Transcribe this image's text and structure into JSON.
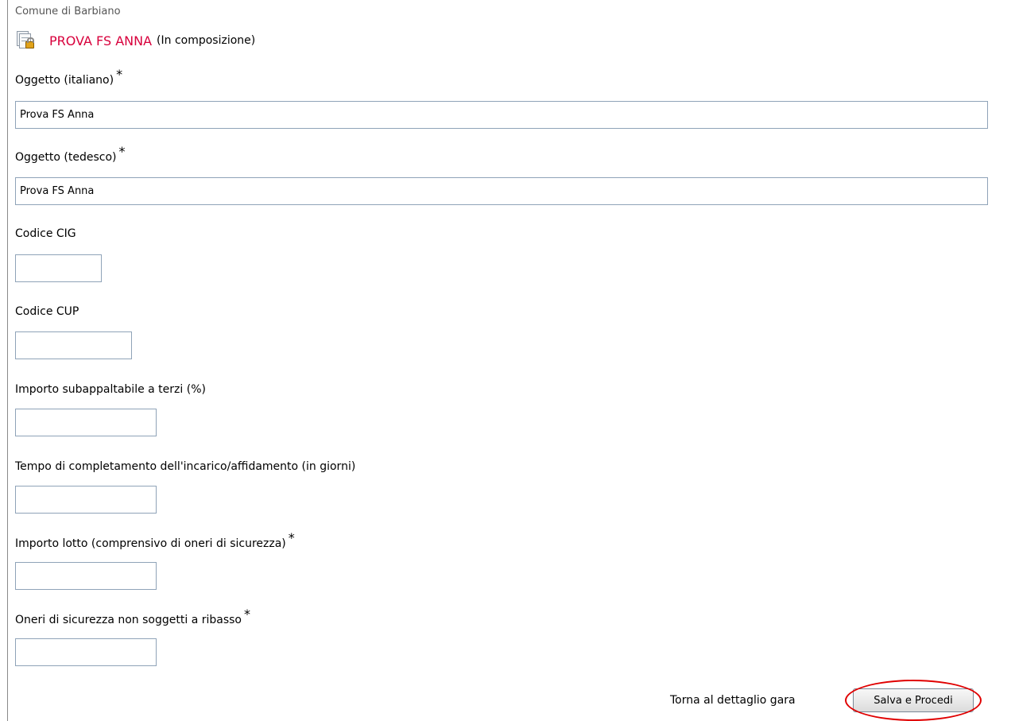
{
  "header": {
    "organization": "Comune di Barbiano",
    "title": "PROVA FS ANNA",
    "status": "(In composizione)",
    "icon": "locked-document-icon"
  },
  "form": {
    "required_marker": "*",
    "oggetto_it": {
      "label": "Oggetto (italiano)",
      "value": "Prova FS Anna"
    },
    "oggetto_de": {
      "label": "Oggetto (tedesco)",
      "value": "Prova FS Anna"
    },
    "codice_cig": {
      "label": "Codice CIG",
      "value": ""
    },
    "codice_cup": {
      "label": "Codice CUP",
      "value": ""
    },
    "importo_subappaltabile": {
      "label": "Importo subappaltabile a terzi (%)",
      "value": ""
    },
    "tempo_completamento": {
      "label": "Tempo di completamento dell'incarico/affidamento (in giorni)",
      "value": ""
    },
    "importo_lotto": {
      "label": "Importo lotto (comprensivo di oneri di sicurezza)",
      "value": ""
    },
    "oneri_sicurezza": {
      "label": "Oneri di sicurezza non soggetti a ribasso",
      "value": ""
    }
  },
  "actions": {
    "back_link": "Torna al dettaglio gara",
    "submit_label": "Salva e Procedi"
  },
  "colors": {
    "title": "#d8003c",
    "highlight": "#e00000",
    "input_border": "#8fa3b8"
  }
}
